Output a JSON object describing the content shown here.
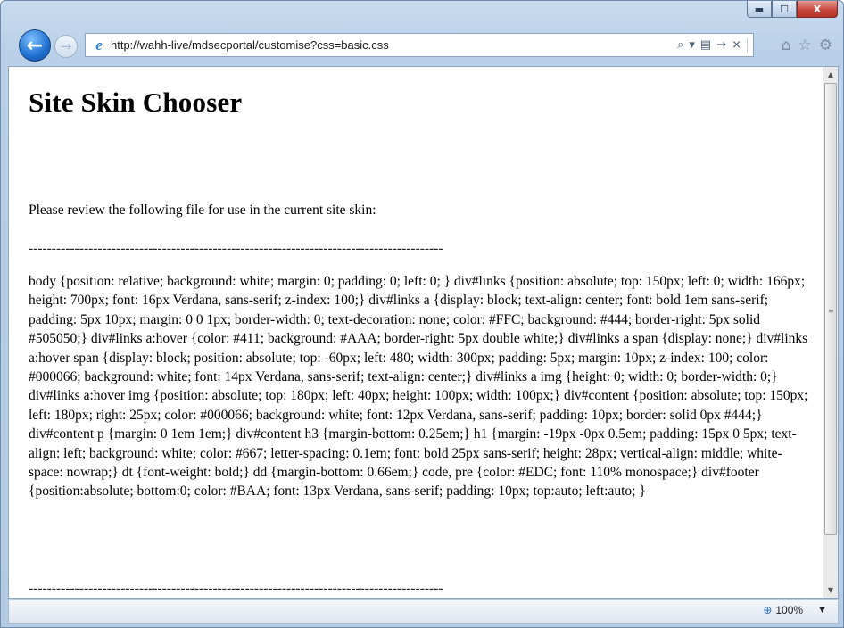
{
  "window": {
    "minimize_glyph": "▬",
    "maximize_glyph": "☐",
    "close_glyph": "X"
  },
  "nav": {
    "back_icon": "arrow-left-icon",
    "back_glyph": "←",
    "forward_icon": "arrow-right-icon",
    "forward_glyph": "→"
  },
  "address": {
    "url": "http://wahh-live/mdsecportal/customise?css=basic.css",
    "search_glyph": "⌕",
    "dropdown_glyph": "▾",
    "compat_glyph": "▤",
    "go_glyph": "→",
    "stop_glyph": "×"
  },
  "toolbar_icons": {
    "home_glyph": "⌂",
    "favorites_glyph": "☆",
    "tools_glyph": "⚙"
  },
  "page": {
    "title": "Site Skin Chooser",
    "intro": "Please review the following file for use in the current site skin:",
    "separator": "------------------------------------------------------------------------------------------",
    "css_content": "body {position: relative; background: white; margin: 0; padding: 0; left: 0; } div#links {position: absolute; top: 150px; left: 0; width: 166px; height: 700px; font: 16px Verdana, sans-serif; z-index: 100;} div#links a {display: block; text-align: center; font: bold 1em sans-serif; padding: 5px 10px; margin: 0 0 1px; border-width: 0; text-decoration: none; color: #FFC; background: #444; border-right: 5px solid #505050;} div#links a:hover {color: #411; background: #AAA; border-right: 5px double white;} div#links a span {display: none;} div#links a:hover span {display: block; position: absolute; top: -60px; left: 480; width: 300px; padding: 5px; margin: 10px; z-index: 100; color: #000066; background: white; font: 14px Verdana, sans-serif; text-align: center;} div#links a img {height: 0; width: 0; border-width: 0;} div#links a:hover img {position: absolute; top: 180px; left: 40px; height: 100px; width: 100px;} div#content {position: absolute; top: 150px; left: 180px; right: 25px; color: #000066; background: white; font: 12px Verdana, sans-serif; padding: 10px; border: solid 0px #444;} div#content p {margin: 0 1em 1em;} div#content h3 {margin-bottom: 0.25em;} h1 {margin: -19px -0px 0.5em; padding: 15px 0 5px; text-align: left; background: white; color: #667; letter-spacing: 0.1em; font: bold 25px sans-serif; height: 28px; vertical-align: middle; white-space: nowrap;} dt {font-weight: bold;} dd {margin-bottom: 0.66em;} code, pre {color: #EDC; font: 110% monospace;} div#footer {position:absolute; bottom:0; color: #BAA; font: 13px Verdana, sans-serif; padding: 10px; top:auto; left:auto; }"
  },
  "scrollbar": {
    "up_glyph": "▲",
    "down_glyph": "▼",
    "grip_glyph": "≡"
  },
  "status": {
    "zoom_icon": "magnifier-icon",
    "zoom_glyph": "⊕",
    "zoom_level": "100%",
    "zoom_dropdown_glyph": "▼"
  }
}
